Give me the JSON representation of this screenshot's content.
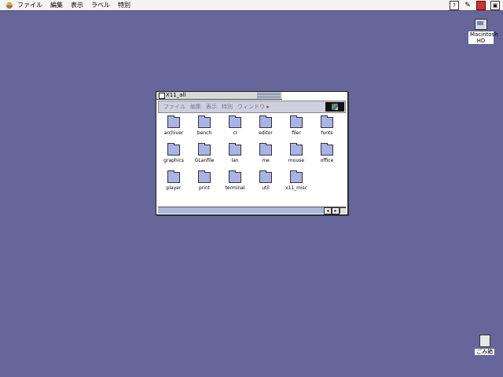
{
  "menubar": {
    "items": [
      "ファイル",
      "編集",
      "表示",
      "ラベル",
      "特別"
    ],
    "right_icons": [
      "help-icon",
      "pencil-icon",
      "app-switcher-icon",
      "finder-icon"
    ]
  },
  "desktop": {
    "hard_disk": {
      "label": "Macintosh HD",
      "icon": "hard-disk-icon"
    },
    "trash": {
      "label": "ごみ箱",
      "icon": "trash-icon"
    }
  },
  "window": {
    "title": "X11_all",
    "toolbar": [
      "ファイル",
      "編集",
      "表示",
      "特別",
      "ウィンドウ"
    ],
    "folders": [
      "archiver",
      "bench",
      "cl",
      "editor",
      "filer",
      "fonts",
      "graphics",
      "GLanfile",
      "lan",
      "me",
      "mouse",
      "office",
      "player",
      "print",
      "terminal",
      "util",
      "x11_misc"
    ]
  },
  "colors": {
    "desktop": "#66669a",
    "folder": "#a9b3e6",
    "toolbar": "#cfcfdf"
  }
}
